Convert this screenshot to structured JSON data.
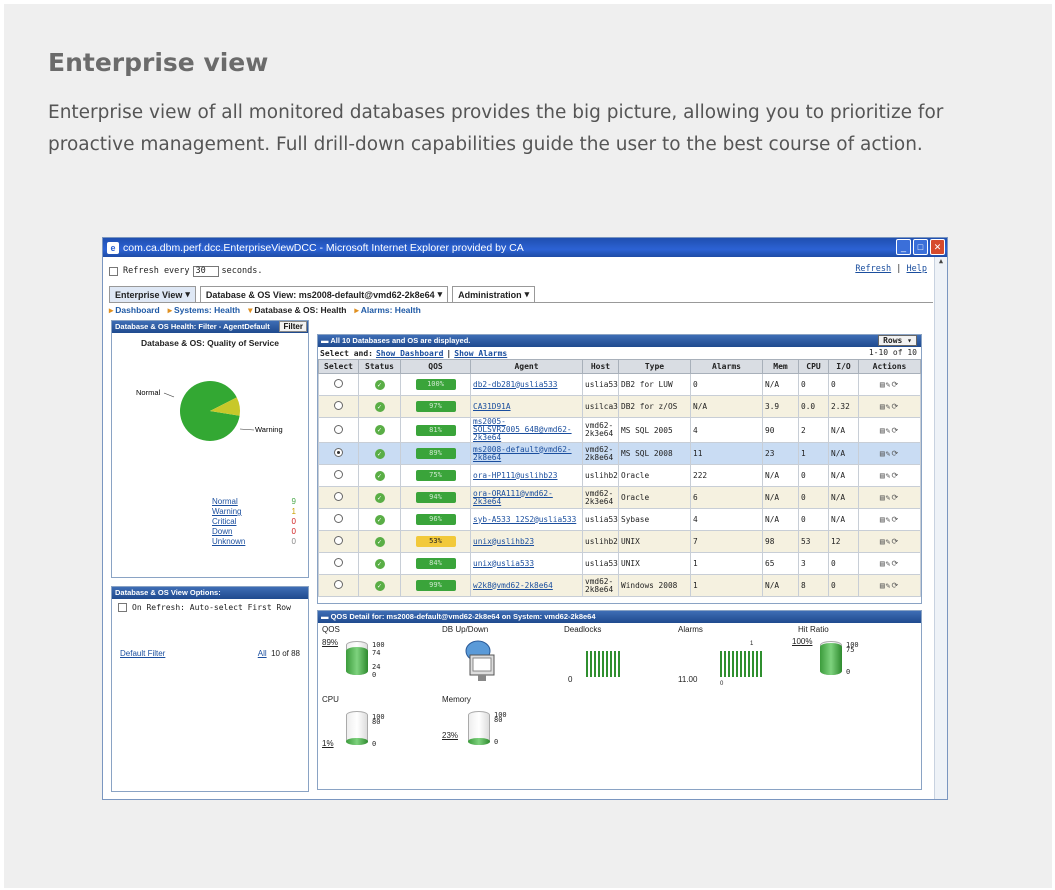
{
  "page": {
    "title": "Enterprise view",
    "intro": "Enterprise view of all monitored databases provides the big picture, allowing you to prioritize for proactive management. Full drill-down capabilities guide the user to the best course of action."
  },
  "window": {
    "title": "com.ca.dbm.perf.dcc.EnterpriseViewDCC - Microsoft Internet Explorer provided by CA",
    "min": "_",
    "max": "□",
    "close": "✕"
  },
  "refresh": {
    "label_pre": "Refresh every",
    "value": "30",
    "label_post": "seconds.",
    "link_refresh": "Refresh",
    "sep": "|",
    "link_help": "Help"
  },
  "tabs": [
    {
      "label": "Enterprise View",
      "arrow": "▾"
    },
    {
      "label": "Database & OS View: ms2008-default@vmd62-2k8e64",
      "arrow": "▾"
    },
    {
      "label": "Administration",
      "arrow": "▾"
    }
  ],
  "crumbs": [
    "Dashboard",
    "Systems: Health",
    "Database & OS: Health",
    "Alarms: Health"
  ],
  "left": {
    "header": "Database & OS Health: Filter - AgentDefault",
    "filter_btn": "Filter",
    "title": "Database & OS: Quality of Service",
    "pie_labels": {
      "normal": "Normal",
      "warning": "Warning"
    },
    "legend": [
      {
        "label": "Normal",
        "count": "9",
        "color": "#4aa84a"
      },
      {
        "label": "Warning",
        "count": "1",
        "color": "#c9a000"
      },
      {
        "label": "Critical",
        "count": "0",
        "color": "#d02020"
      },
      {
        "label": "Down",
        "count": "0",
        "color": "#d02020"
      },
      {
        "label": "Unknown",
        "count": "0",
        "color": "#888"
      }
    ],
    "default_filter": "Default Filter",
    "all": "All",
    "all_count": "10 of 88",
    "options_header": "Database & OS View Options:",
    "option": "On Refresh: Auto-select First Row"
  },
  "pie": {
    "normal": 9,
    "warning": 1
  },
  "main": {
    "header": "All 10 Databases and OS are displayed.",
    "rows_btn": "Rows ▾",
    "select_and": "Select and:",
    "show_dashboard": "Show Dashboard",
    "sep": "|",
    "show_alarms": "Show Alarms",
    "count": "1-10 of 10",
    "columns": [
      "Select",
      "Status",
      "QOS",
      "Agent",
      "Host",
      "Type",
      "Alarms",
      "Mem",
      "CPU",
      "I/O",
      "Actions"
    ],
    "rows": [
      {
        "qos": "100%",
        "agent": "db2-db281@uslia533",
        "host": "uslia533",
        "type": "DB2 for LUW",
        "alarms": "0",
        "mem": "N/A",
        "cpu": "0",
        "io": "0",
        "sel": false,
        "style": ""
      },
      {
        "qos": "97%",
        "agent": "CA31D91A",
        "host": "usilca31",
        "type": "DB2 for z/OS",
        "alarms": "N/A",
        "mem": "3.9",
        "cpu": "0.0",
        "io": "2.32",
        "sel": false,
        "style": "alt"
      },
      {
        "qos": "81%",
        "agent": "ms2005-SOLSVR2005_64B@vmd62-2k3e64",
        "host": "vmd62-2k3e64",
        "type": "MS SQL 2005",
        "alarms": "4",
        "mem": "90",
        "cpu": "2",
        "io": "N/A",
        "sel": false,
        "style": ""
      },
      {
        "qos": "89%",
        "agent": "ms2008-default@vmd62-2k8e64",
        "host": "vmd62-2k8e64",
        "type": "MS SQL 2008",
        "alarms": "11",
        "mem": "23",
        "cpu": "1",
        "io": "N/A",
        "sel": true,
        "style": "sel"
      },
      {
        "qos": "75%",
        "agent": "ora-HP111@uslihb23",
        "host": "uslihb23",
        "type": "Oracle",
        "alarms": "222",
        "mem": "N/A",
        "cpu": "0",
        "io": "N/A",
        "sel": false,
        "style": ""
      },
      {
        "qos": "94%",
        "agent": "ora-ORA111@vmd62-2k3e64",
        "host": "vmd62-2k3e64",
        "type": "Oracle",
        "alarms": "6",
        "mem": "N/A",
        "cpu": "0",
        "io": "N/A",
        "sel": false,
        "style": "alt"
      },
      {
        "qos": "96%",
        "agent": "syb-A533_12S2@uslia533",
        "host": "uslia533",
        "type": "Sybase",
        "alarms": "4",
        "mem": "N/A",
        "cpu": "0",
        "io": "N/A",
        "sel": false,
        "style": ""
      },
      {
        "qos": "53%",
        "agent": "unix@uslihb23",
        "host": "uslihb23",
        "type": "UNIX",
        "alarms": "7",
        "mem": "98",
        "cpu": "53",
        "io": "12",
        "sel": false,
        "style": "alt",
        "yellow": true
      },
      {
        "qos": "84%",
        "agent": "unix@uslia533",
        "host": "uslia533",
        "type": "UNIX",
        "alarms": "1",
        "mem": "65",
        "cpu": "3",
        "io": "0",
        "sel": false,
        "style": ""
      },
      {
        "qos": "99%",
        "agent": "w2k8@vmd62-2k8e64",
        "host": "vmd62-2k8e64",
        "type": "Windows 2008",
        "alarms": "1",
        "mem": "N/A",
        "cpu": "8",
        "io": "0",
        "sel": false,
        "style": "alt"
      }
    ]
  },
  "detail": {
    "header": "QOS Detail for: ms2008-default@vmd62-2k8e64 on System: vmd62-2k8e64",
    "qos": {
      "label": "QOS",
      "value": "89%",
      "level": 0.89,
      "ticks": [
        "100",
        "74",
        "24",
        "0"
      ]
    },
    "dbupdown": {
      "label": "DB Up/Down"
    },
    "deadlocks": {
      "label": "Deadlocks",
      "value": "0"
    },
    "alarms": {
      "label": "Alarms",
      "value": "11.00",
      "tick_top": "1",
      "tick_bot": "0"
    },
    "hitratio": {
      "label": "Hit Ratio",
      "value": "100%",
      "level": 1.0,
      "ticks": [
        "100",
        "75",
        "0"
      ]
    },
    "cpu": {
      "label": "CPU",
      "value": "1%",
      "level": 0.01,
      "ticks": [
        "100",
        "80",
        "0"
      ]
    },
    "memory": {
      "label": "Memory",
      "value": "23%",
      "level": 0.23,
      "ticks": [
        "100",
        "80",
        "0"
      ]
    }
  }
}
